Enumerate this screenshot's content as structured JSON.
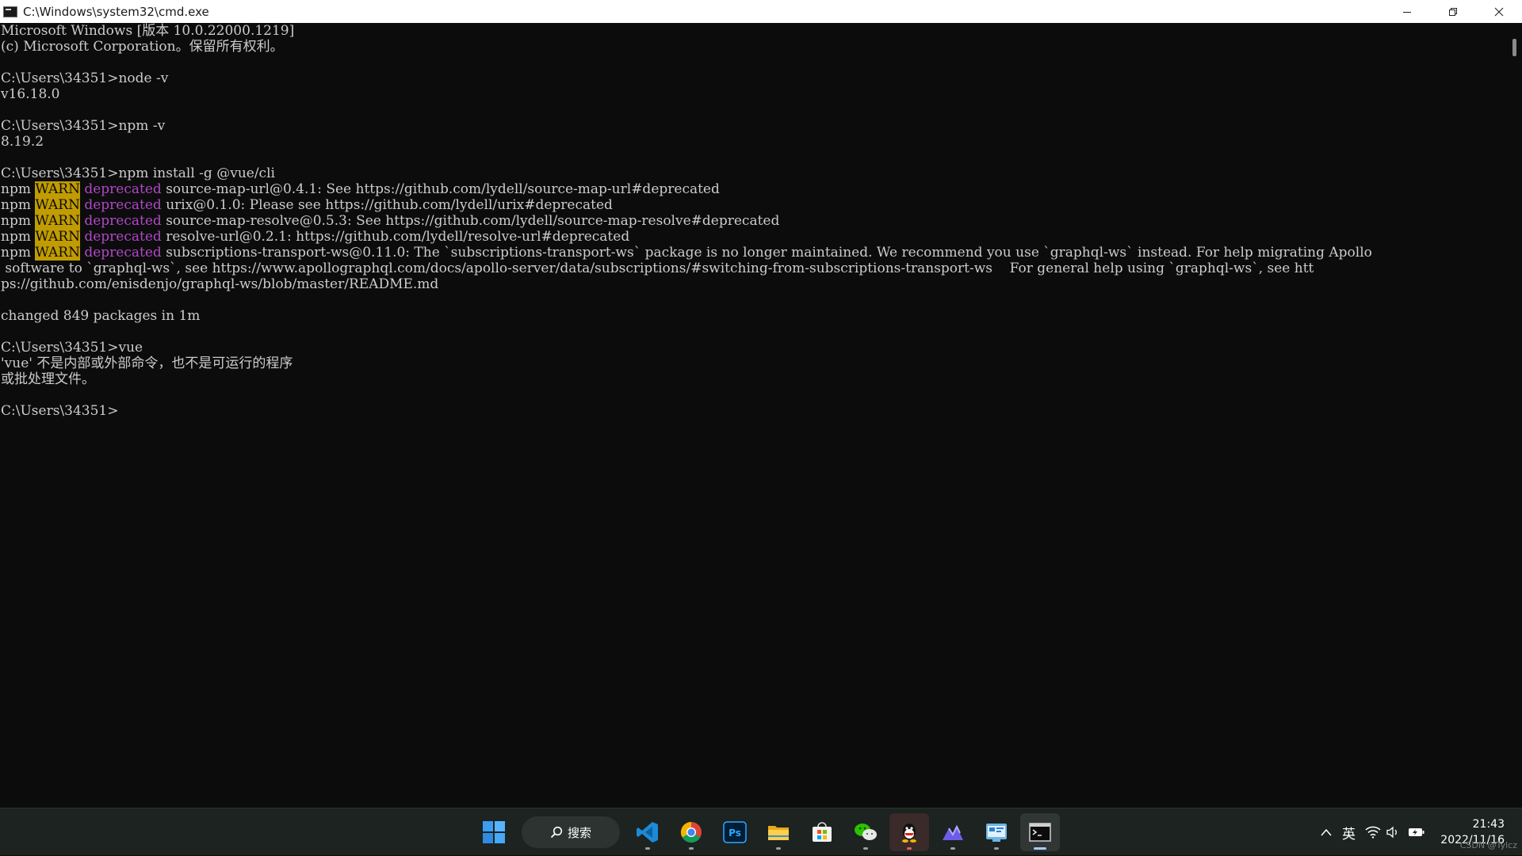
{
  "window": {
    "title": "C:\\Windows\\system32\\cmd.exe"
  },
  "console": {
    "lines": [
      {
        "parts": [
          {
            "t": "Microsoft Windows [版本 10.0.22000.1219]"
          }
        ]
      },
      {
        "parts": [
          {
            "t": "(c) Microsoft Corporation。保留所有权利。"
          }
        ]
      },
      {
        "parts": [
          {
            "t": ""
          }
        ]
      },
      {
        "parts": [
          {
            "t": "C:\\Users\\34351>node -v"
          }
        ]
      },
      {
        "parts": [
          {
            "t": "v16.18.0"
          }
        ]
      },
      {
        "parts": [
          {
            "t": ""
          }
        ]
      },
      {
        "parts": [
          {
            "t": "C:\\Users\\34351>npm -v"
          }
        ]
      },
      {
        "parts": [
          {
            "t": "8.19.2"
          }
        ]
      },
      {
        "parts": [
          {
            "t": ""
          }
        ]
      },
      {
        "parts": [
          {
            "t": "C:\\Users\\34351>npm install -g @vue/cli"
          }
        ]
      },
      {
        "parts": [
          {
            "t": "npm "
          },
          {
            "t": "WARN",
            "s": "warn"
          },
          {
            "t": " "
          },
          {
            "t": "deprecated",
            "s": "depr"
          },
          {
            "t": " source-map-url@0.4.1: See https://github.com/lydell/source-map-url#deprecated"
          }
        ]
      },
      {
        "parts": [
          {
            "t": "npm "
          },
          {
            "t": "WARN",
            "s": "warn"
          },
          {
            "t": " "
          },
          {
            "t": "deprecated",
            "s": "depr"
          },
          {
            "t": " urix@0.1.0: Please see https://github.com/lydell/urix#deprecated"
          }
        ]
      },
      {
        "parts": [
          {
            "t": "npm "
          },
          {
            "t": "WARN",
            "s": "warn"
          },
          {
            "t": " "
          },
          {
            "t": "deprecated",
            "s": "depr"
          },
          {
            "t": " source-map-resolve@0.5.3: See https://github.com/lydell/source-map-resolve#deprecated"
          }
        ]
      },
      {
        "parts": [
          {
            "t": "npm "
          },
          {
            "t": "WARN",
            "s": "warn"
          },
          {
            "t": " "
          },
          {
            "t": "deprecated",
            "s": "depr"
          },
          {
            "t": " resolve-url@0.2.1: https://github.com/lydell/resolve-url#deprecated"
          }
        ]
      },
      {
        "parts": [
          {
            "t": "npm "
          },
          {
            "t": "WARN",
            "s": "warn"
          },
          {
            "t": " "
          },
          {
            "t": "deprecated",
            "s": "depr"
          },
          {
            "t": " subscriptions-transport-ws@0.11.0: The `subscriptions-transport-ws` package is no longer maintained. We recommend you use `graphql-ws` instead. For help migrating Apollo"
          }
        ]
      },
      {
        "parts": [
          {
            "t": " software to `graphql-ws`, see https://www.apollographql.com/docs/apollo-server/data/subscriptions/#switching-from-subscriptions-transport-ws    For general help using `graphql-ws`, see htt"
          }
        ]
      },
      {
        "parts": [
          {
            "t": "ps://github.com/enisdenjo/graphql-ws/blob/master/README.md"
          }
        ]
      },
      {
        "parts": [
          {
            "t": ""
          }
        ]
      },
      {
        "parts": [
          {
            "t": "changed 849 packages in 1m"
          }
        ]
      },
      {
        "parts": [
          {
            "t": ""
          }
        ]
      },
      {
        "parts": [
          {
            "t": "C:\\Users\\34351>vue"
          }
        ]
      },
      {
        "parts": [
          {
            "t": "'vue' 不是内部或外部命令，也不是可运行的程序"
          }
        ]
      },
      {
        "parts": [
          {
            "t": "或批处理文件。"
          }
        ]
      },
      {
        "parts": [
          {
            "t": ""
          }
        ]
      },
      {
        "parts": [
          {
            "t": "C:\\Users\\34351>"
          }
        ]
      }
    ]
  },
  "taskbar": {
    "search_label": "搜索",
    "apps": [
      {
        "name": "vscode-icon",
        "state": "running"
      },
      {
        "name": "chrome-icon",
        "state": "running"
      },
      {
        "name": "photoshop-icon",
        "state": "idle"
      },
      {
        "name": "file-explorer-icon",
        "state": "running"
      },
      {
        "name": "microsoft-store-icon",
        "state": "idle"
      },
      {
        "name": "wechat-icon",
        "state": "running"
      },
      {
        "name": "qq-icon",
        "state": "active"
      },
      {
        "name": "drawing-app-icon",
        "state": "running"
      },
      {
        "name": "control-panel-icon",
        "state": "running"
      },
      {
        "name": "terminal-icon",
        "state": "current"
      }
    ],
    "ime_label": "英",
    "time": "21:43",
    "date": "2022/11/16"
  },
  "watermark": "CSDN @Tylcz",
  "colors": {
    "console_bg": "#0c0c0c",
    "console_text": "#cccccc",
    "warn_bg": "#c19c00",
    "deprecated_text": "#b148c6",
    "taskbar_bg": "#1c2320"
  }
}
